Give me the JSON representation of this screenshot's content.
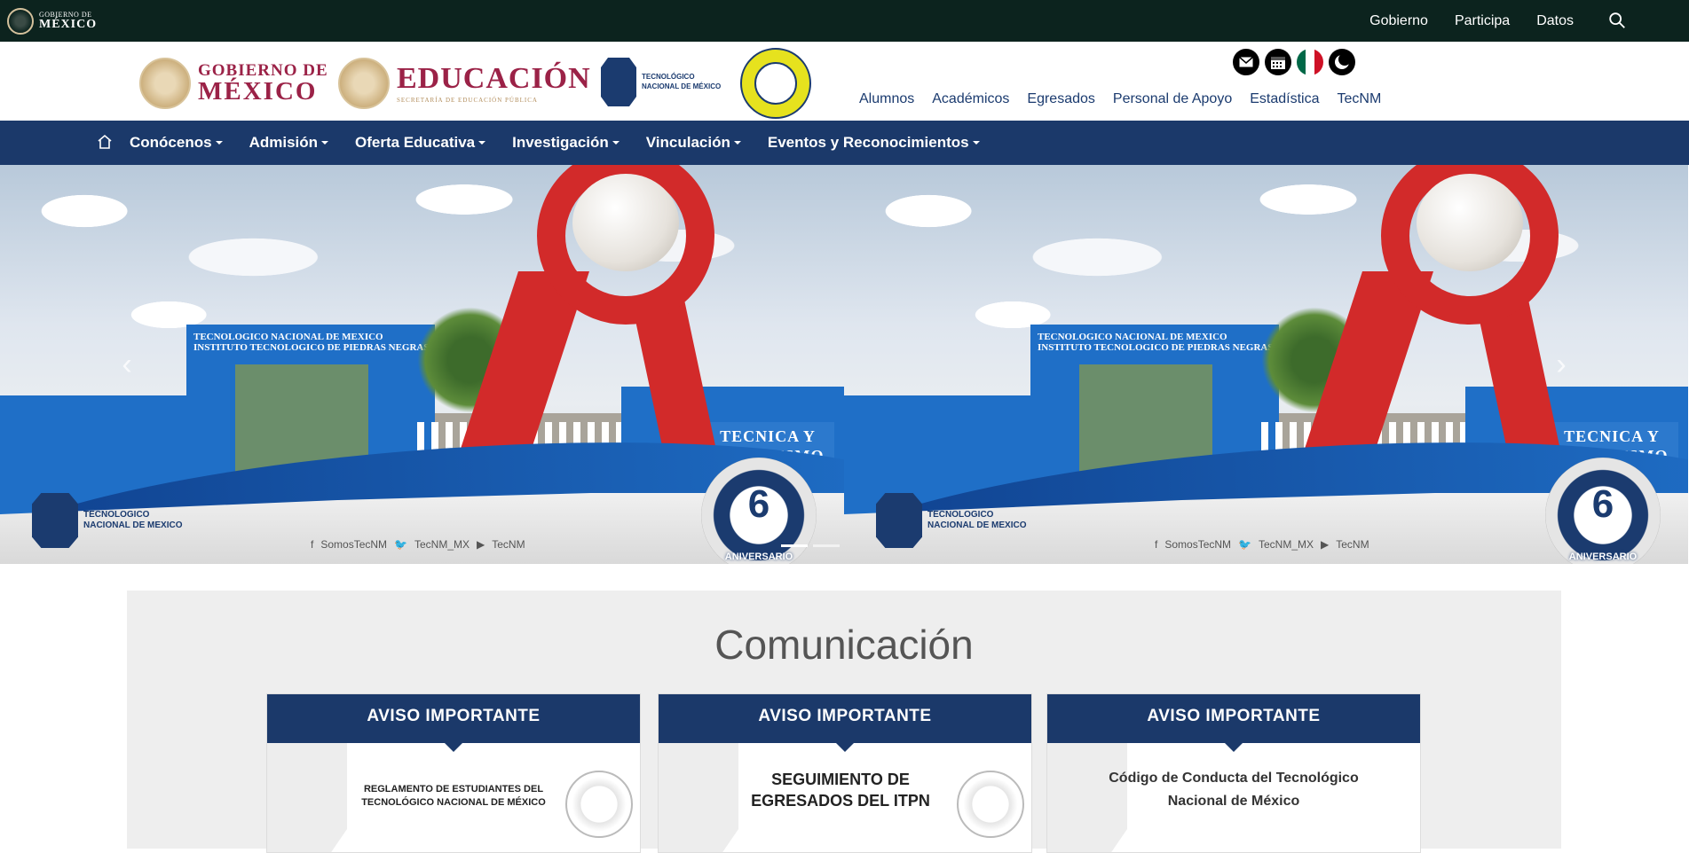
{
  "gov_bar": {
    "logo_line1": "GOBIERNO DE",
    "logo_line2": "MÉXICO",
    "nav": [
      "Gobierno",
      "Participa",
      "Datos"
    ]
  },
  "header": {
    "gob_line1": "GOBIERNO DE",
    "gob_line2": "MÉXICO",
    "sep_line1": "EDUCACIÓN",
    "sep_line2": "SECRETARÍA DE EDUCACIÓN PÚBLICA",
    "tecnm_line1": "TECNOLÓGICO",
    "tecnm_line2": "NACIONAL DE MÉXICO",
    "secondary_nav": [
      "Alumnos",
      "Académicos",
      "Egresados",
      "Personal de Apoyo",
      "Estadística",
      "TecNM"
    ]
  },
  "main_nav": {
    "items": [
      "Conócenos",
      "Admisión",
      "Oferta Educativa",
      "Investigación",
      "Vinculación",
      "Eventos y Reconocimientos"
    ]
  },
  "carousel": {
    "gate_label": "TECNOLOGICO NACIONAL DE MEXICO INSTITUTO TECNOLOGICO DE PIEDRAS NEGRAS",
    "sign_text": "TECNICA Y HUMANISMO",
    "tecnm_line1": "TECNOLOGICO",
    "tecnm_line2": "NACIONAL DE MEXICO",
    "social_fb": "SomosTecNM",
    "social_tw": "TecNM_MX",
    "social_yt": "TecNM",
    "badge_number": "6",
    "badge_text": "ANIVERSARIO"
  },
  "communication": {
    "title": "Comunicación",
    "cards": [
      {
        "header": "AVISO IMPORTANTE",
        "body": "REGLAMENTO DE ESTUDIANTES DEL TECNOLÓGICO NACIONAL DE MÉXICO"
      },
      {
        "header": "AVISO IMPORTANTE",
        "body": "SEGUIMIENTO DE EGRESADOS DEL ITPN"
      },
      {
        "header": "AVISO IMPORTANTE",
        "body": "Código de Conducta del Tecnológico Nacional de México"
      }
    ]
  }
}
